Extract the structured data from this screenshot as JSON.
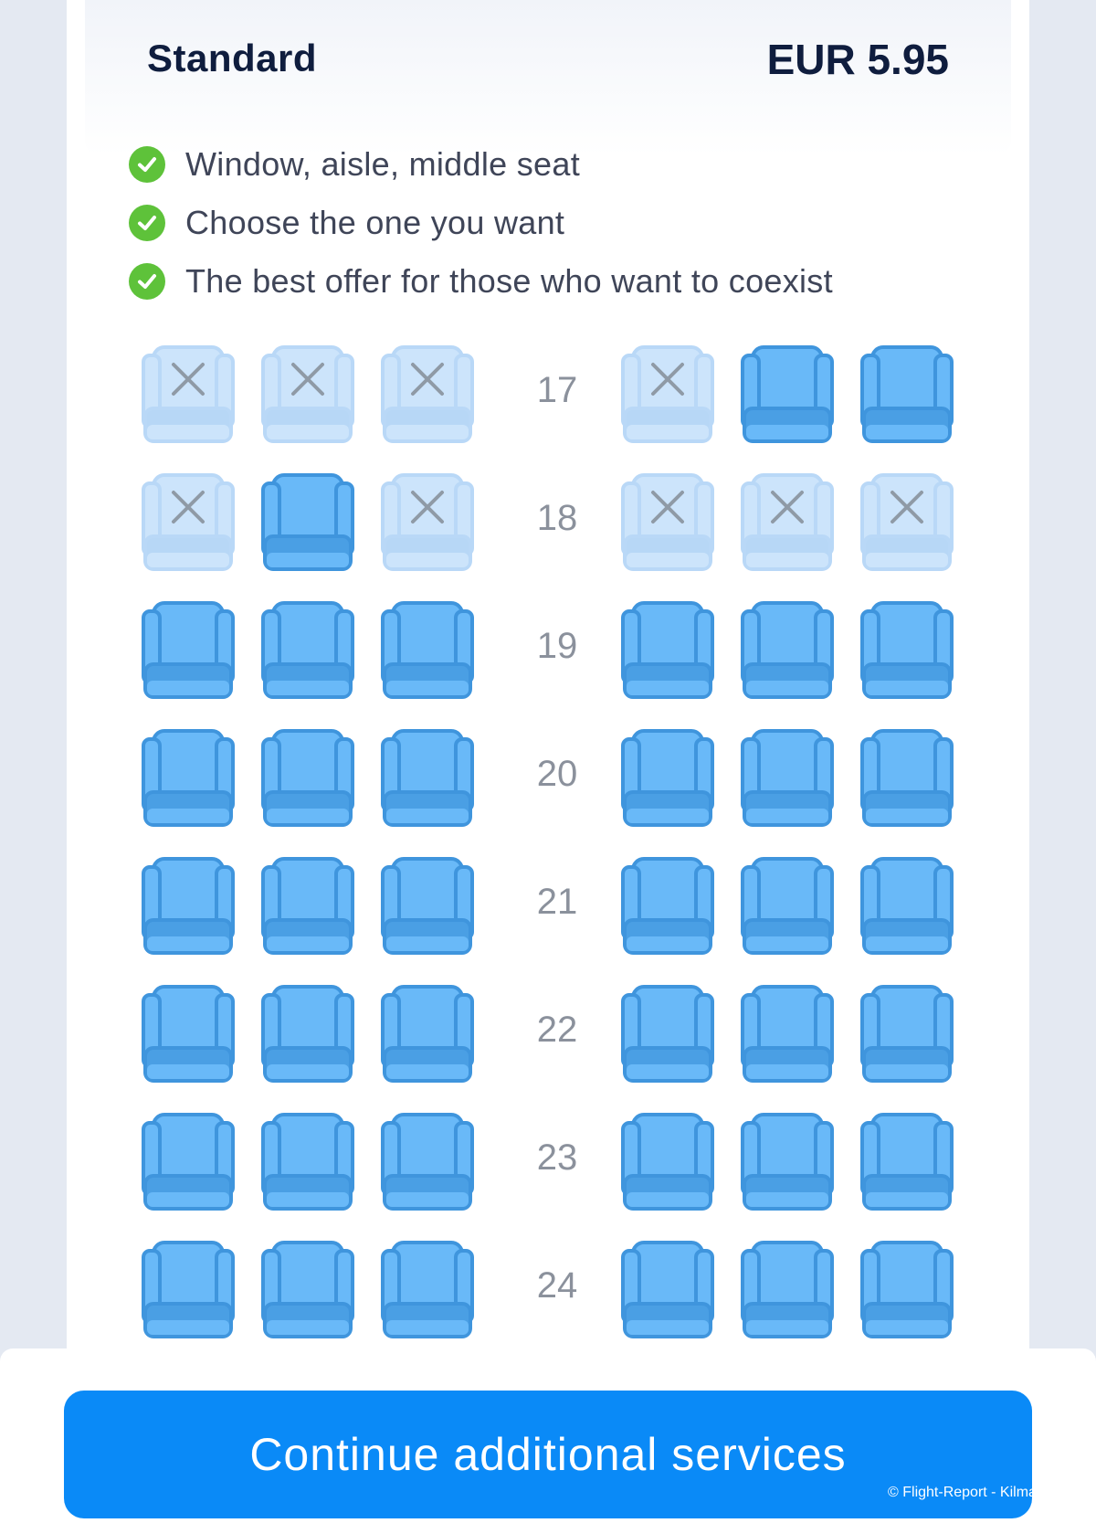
{
  "tier": {
    "name": "Standard",
    "price": "EUR 5.95"
  },
  "features": [
    "Window, aisle, middle seat",
    "Choose the one you want",
    "The best offer for those who want to coexist"
  ],
  "colors": {
    "seat_available": "#69b9f8",
    "seat_available_dark": "#4a9fe4",
    "seat_taken": "#cce4fb",
    "check": "#5ec23a",
    "button": "#0a8af7"
  },
  "seat_rows": [
    {
      "number": "17",
      "seats": [
        "taken",
        "taken",
        "taken",
        "taken",
        "available",
        "available"
      ]
    },
    {
      "number": "18",
      "seats": [
        "taken",
        "available",
        "taken",
        "taken",
        "taken",
        "taken"
      ]
    },
    {
      "number": "19",
      "seats": [
        "available",
        "available",
        "available",
        "available",
        "available",
        "available"
      ]
    },
    {
      "number": "20",
      "seats": [
        "available",
        "available",
        "available",
        "available",
        "available",
        "available"
      ]
    },
    {
      "number": "21",
      "seats": [
        "available",
        "available",
        "available",
        "available",
        "available",
        "available"
      ]
    },
    {
      "number": "22",
      "seats": [
        "available",
        "available",
        "available",
        "available",
        "available",
        "available"
      ]
    },
    {
      "number": "23",
      "seats": [
        "available",
        "available",
        "available",
        "available",
        "available",
        "available"
      ]
    },
    {
      "number": "24",
      "seats": [
        "available",
        "available",
        "available",
        "available",
        "available",
        "available"
      ]
    }
  ],
  "continue_button": {
    "label": "Continue additional services"
  },
  "watermark": "© Flight-Report - Kilma"
}
